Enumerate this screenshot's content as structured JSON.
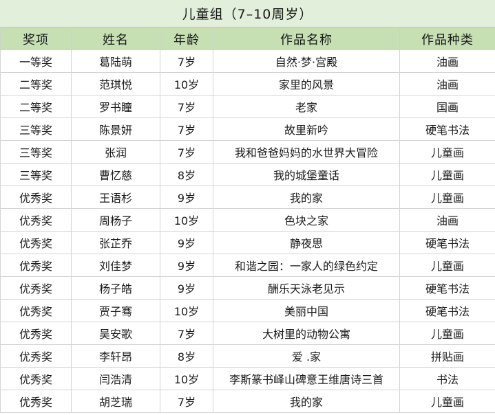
{
  "title": "儿童组（7–10周岁）",
  "columns": [
    "奖项",
    "姓名",
    "年龄",
    "作品名称",
    "作品种类"
  ],
  "rows": [
    [
      "一等奖",
      "葛陆萌",
      "7岁",
      "自然·梦·宫殿",
      "油画"
    ],
    [
      "二等奖",
      "范琪悦",
      "10岁",
      "家里的风景",
      "油画"
    ],
    [
      "二等奖",
      "罗书瞳",
      "7岁",
      "老家",
      "国画"
    ],
    [
      "三等奖",
      "陈景妍",
      "7岁",
      "故里新吟",
      "硬笔书法"
    ],
    [
      "三等奖",
      "张润",
      "7岁",
      "我和爸爸妈妈的水世界大冒险",
      "儿童画"
    ],
    [
      "三等奖",
      "曹忆慈",
      "8岁",
      "我的城堡童话",
      "儿童画"
    ],
    [
      "优秀奖",
      "王语杉",
      "9岁",
      "我的家",
      "儿童画"
    ],
    [
      "优秀奖",
      "周杨子",
      "10岁",
      "色块之家",
      "油画"
    ],
    [
      "优秀奖",
      "张芷乔",
      "9岁",
      "静夜思",
      "硬笔书法"
    ],
    [
      "优秀奖",
      "刘佳梦",
      "9岁",
      "和谐之园：一家人的绿色约定",
      "儿童画"
    ],
    [
      "优秀奖",
      "杨子皓",
      "9岁",
      "酬乐天泳老见示",
      "硬笔书法"
    ],
    [
      "优秀奖",
      "贾子骞",
      "10岁",
      "美丽中国",
      "硬笔书法"
    ],
    [
      "优秀奖",
      "吴安歌",
      "7岁",
      "大树里的动物公寓",
      "儿童画"
    ],
    [
      "优秀奖",
      "李轩昂",
      "8岁",
      "爱 .家",
      "拼贴画"
    ],
    [
      "优秀奖",
      "闫浩清",
      "10岁",
      "李斯篆书峄山碑意王维唐诗三首",
      "书法"
    ],
    [
      "优秀奖",
      "胡芝瑞",
      "7岁",
      "我的家",
      "儿童画"
    ]
  ]
}
